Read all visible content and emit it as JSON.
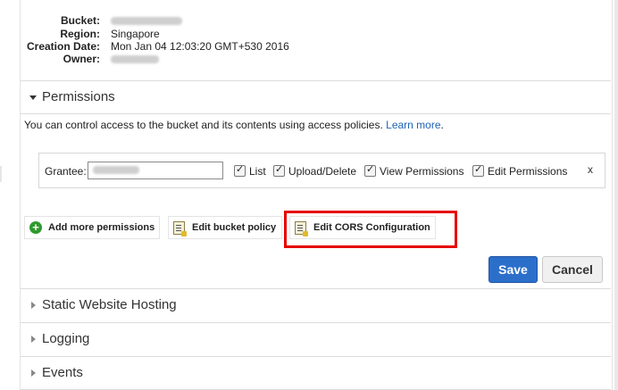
{
  "properties": [
    {
      "label": "Bucket:",
      "value": "",
      "redacted": true
    },
    {
      "label": "Region:",
      "value": "Singapore",
      "redacted": false
    },
    {
      "label": "Creation Date:",
      "value": "Mon Jan 04 12:03:20 GMT+530 2016",
      "redacted": false
    },
    {
      "label": "Owner:",
      "value": "",
      "redacted": true
    }
  ],
  "permissions": {
    "title": "Permissions",
    "info_text": "You can control access to the bucket and its contents using access policies.",
    "learn_more": "Learn more",
    "info_suffix": ".",
    "grantee_label": "Grantee:",
    "grantee_value": "",
    "checkboxes": [
      {
        "label": "List",
        "checked": true
      },
      {
        "label": "Upload/Delete",
        "checked": true
      },
      {
        "label": "View Permissions",
        "checked": true
      },
      {
        "label": "Edit Permissions",
        "checked": true
      }
    ],
    "remove_label": "x",
    "actions": {
      "add_more": "Add more permissions",
      "edit_policy": "Edit bucket policy",
      "edit_cors": "Edit CORS Configuration"
    },
    "save": "Save",
    "cancel": "Cancel"
  },
  "sections": [
    {
      "title": "Static Website Hosting"
    },
    {
      "title": "Logging"
    },
    {
      "title": "Events"
    }
  ],
  "colors": {
    "link": "#1f63b6",
    "primary_button": "#2c6fcb",
    "highlight": "#e60000"
  }
}
